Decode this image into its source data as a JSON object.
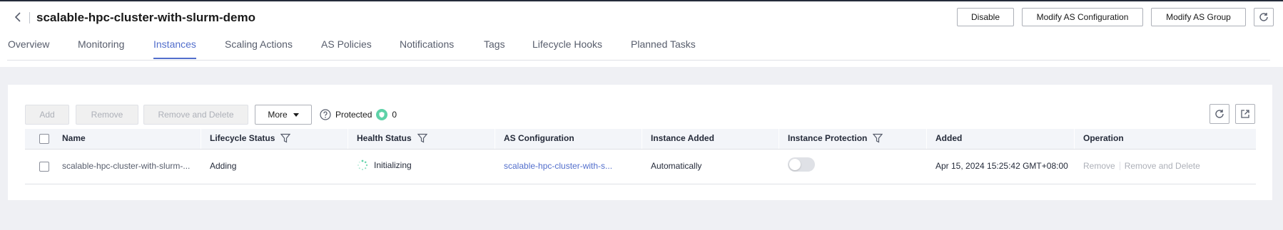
{
  "header": {
    "title": "scalable-hpc-cluster-with-slurm-demo",
    "buttons": {
      "disable": "Disable",
      "modify_config": "Modify AS Configuration",
      "modify_group": "Modify AS Group"
    },
    "back_icon": "chevron-left-icon",
    "refresh_icon": "refresh-icon"
  },
  "tabs": [
    {
      "label": "Overview",
      "active": false
    },
    {
      "label": "Monitoring",
      "active": false
    },
    {
      "label": "Instances",
      "active": true
    },
    {
      "label": "Scaling Actions",
      "active": false
    },
    {
      "label": "AS Policies",
      "active": false
    },
    {
      "label": "Notifications",
      "active": false
    },
    {
      "label": "Tags",
      "active": false
    },
    {
      "label": "Lifecycle Hooks",
      "active": false
    },
    {
      "label": "Planned Tasks",
      "active": false
    }
  ],
  "toolbar": {
    "add": "Add",
    "remove": "Remove",
    "remove_delete": "Remove and Delete",
    "more": "More",
    "protected_label": "Protected",
    "protected_count": "0"
  },
  "table": {
    "columns": {
      "name": "Name",
      "lifecycle": "Lifecycle Status",
      "health": "Health Status",
      "config": "AS Configuration",
      "instance_added": "Instance Added",
      "protection": "Instance Protection",
      "added": "Added",
      "operation": "Operation"
    },
    "rows": [
      {
        "name": "scalable-hpc-cluster-with-slurm-...",
        "lifecycle": "Adding",
        "health": "Initializing",
        "config": "scalable-hpc-cluster-with-s...",
        "instance_added": "Automatically",
        "protection_on": false,
        "added": "Apr 15, 2024 15:25:42 GMT+08:00",
        "op_remove": "Remove",
        "op_remove_delete": "Remove and Delete"
      }
    ]
  },
  "colors": {
    "accent": "#526ecc",
    "protected_badge": "#5ed2a8",
    "page_bg": "#eff0f4"
  }
}
